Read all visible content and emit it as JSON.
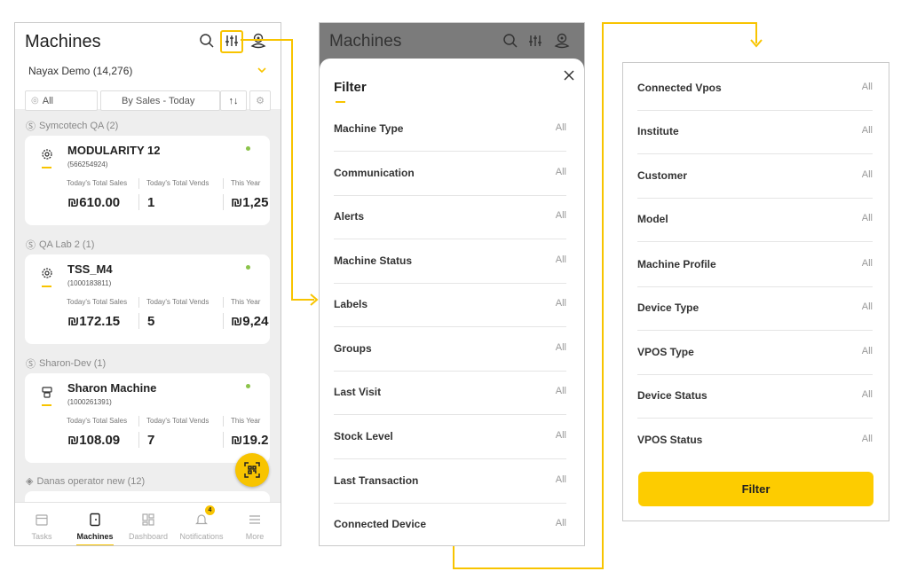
{
  "colors": {
    "accent": "#f8c400",
    "status_online": "#8bc34a"
  },
  "machines_screen": {
    "title": "Machines",
    "header_icons": [
      "search-icon",
      "sliders-icon",
      "location-pin-icon"
    ],
    "account": "Nayax Demo (14,276)",
    "filter_view": "All",
    "sort_by": "By Sales - Today",
    "groups": [
      {
        "name": "Symcotech QA (2)",
        "machine": {
          "name": "MODULARITY 12",
          "id": "(566254924)",
          "icon": "gear-icon",
          "labels": [
            "Today's Total Sales",
            "Today's Total Vends",
            "This Year"
          ],
          "values": [
            "₪610.00",
            "1",
            "₪1,25"
          ]
        }
      },
      {
        "name": "QA Lab 2 (1)",
        "machine": {
          "name": "TSS_M4",
          "id": "(1000183811)",
          "icon": "gear-icon",
          "labels": [
            "Today's Total Sales",
            "Today's Total Vends",
            "This Year"
          ],
          "values": [
            "₪172.15",
            "5",
            "₪9,24"
          ]
        }
      },
      {
        "name": "Sharon-Dev (1)",
        "machine": {
          "name": "Sharon Machine",
          "id": "(1000261391)",
          "icon": "coffee-machine-icon",
          "labels": [
            "Today's Total Sales",
            "Today's Total Vends",
            "This Year"
          ],
          "values": [
            "₪108.09",
            "7",
            "₪19.2"
          ]
        }
      },
      {
        "name": "Danas operator new (12)"
      }
    ],
    "tabs": [
      {
        "label": "Tasks",
        "icon": "calendar-icon"
      },
      {
        "label": "Machines",
        "icon": "machine-icon"
      },
      {
        "label": "Dashboard",
        "icon": "dashboard-icon"
      },
      {
        "label": "Notifications",
        "icon": "bell-icon",
        "badge": "4"
      },
      {
        "label": "More",
        "icon": "menu-icon"
      }
    ]
  },
  "filter_screen": {
    "bg_title": "Machines",
    "title": "Filter",
    "rows": [
      {
        "label": "Machine Type",
        "value": "All"
      },
      {
        "label": "Communication",
        "value": "All"
      },
      {
        "label": "Alerts",
        "value": "All"
      },
      {
        "label": "Machine Status",
        "value": "All"
      },
      {
        "label": "Labels",
        "value": "All"
      },
      {
        "label": "Groups",
        "value": "All"
      },
      {
        "label": "Last Visit",
        "value": "All"
      },
      {
        "label": "Stock Level",
        "value": "All"
      },
      {
        "label": "Last Transaction",
        "value": "All"
      },
      {
        "label": "Connected Device",
        "value": "All"
      }
    ]
  },
  "filter_continued": {
    "rows": [
      {
        "label": "Connected Vpos",
        "value": "All"
      },
      {
        "label": "Institute",
        "value": "All"
      },
      {
        "label": "Customer",
        "value": "All"
      },
      {
        "label": "Model",
        "value": "All"
      },
      {
        "label": "Machine Profile",
        "value": "All"
      },
      {
        "label": "Device Type",
        "value": "All"
      },
      {
        "label": "VPOS Type",
        "value": "All"
      },
      {
        "label": "Device Status",
        "value": "All"
      },
      {
        "label": "VPOS Status",
        "value": "All"
      }
    ],
    "button": "Filter"
  }
}
